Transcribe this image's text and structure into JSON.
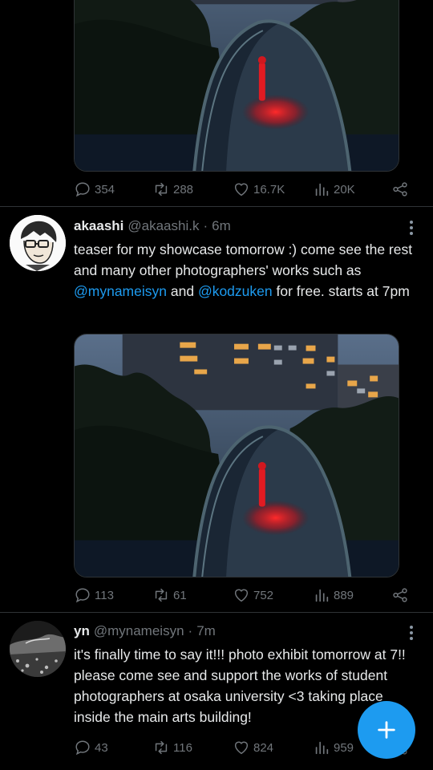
{
  "colors": {
    "accent": "#1d9bf0",
    "text": "#e7e9ea",
    "muted": "#71767b",
    "bg": "#000000"
  },
  "icons": {
    "reply": "reply-icon",
    "retweet": "retweet-icon",
    "like": "heart-icon",
    "views": "views-icon",
    "share": "share-icon",
    "compose": "plus-icon",
    "more": "more-icon"
  },
  "top_post": {
    "stats": {
      "replies": "354",
      "retweets": "288",
      "likes": "16.7K",
      "views": "20K"
    }
  },
  "tweet1": {
    "name": "akaashi",
    "handle": "@akaashi.k",
    "separator": "·",
    "time": "6m",
    "text_1": "teaser for my showcase tomorrow :) come see the rest and many other photographers' works such as ",
    "mention_1": "@mynameisyn",
    "text_2": " and ",
    "mention_2": "@kodzuken",
    "text_3": " for free. starts at 7pm",
    "stats": {
      "replies": "113",
      "retweets": "61",
      "likes": "752",
      "views": "889"
    }
  },
  "tweet2": {
    "name": "yn",
    "handle": "@mynameisyn",
    "separator": "·",
    "time": "7m",
    "text": "it's finally time to say it!!! photo exhibit tomorrow at 7!! please come see and support the works of student photographers at osaka university <3 taking place inside the main arts building!",
    "stats": {
      "replies": "43",
      "retweets": "116",
      "likes": "824",
      "views": "959"
    }
  }
}
